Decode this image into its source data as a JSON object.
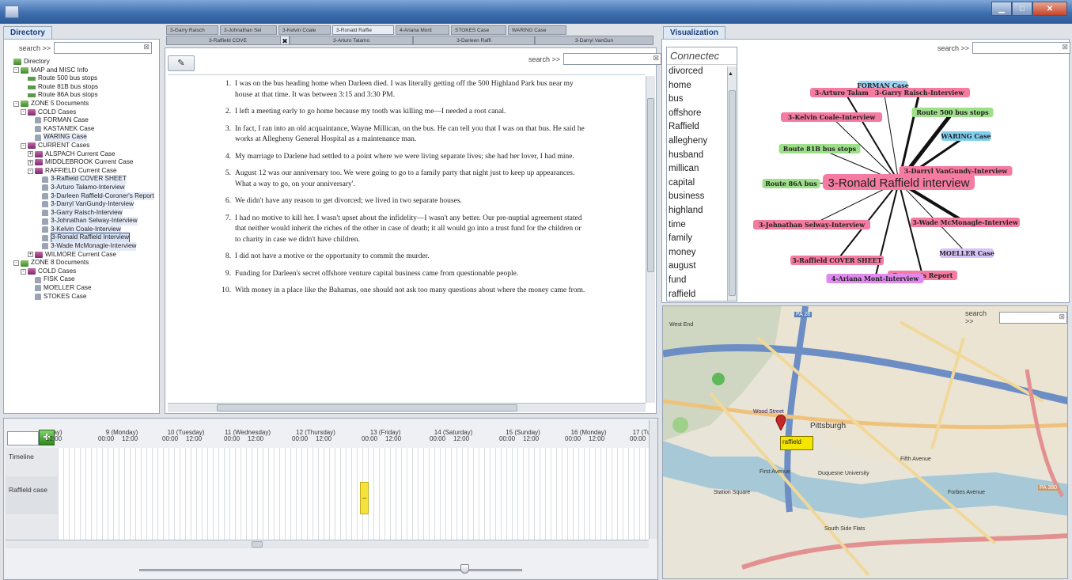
{
  "window": {
    "title": ""
  },
  "directory": {
    "tab": "Directory",
    "search_label": "search >>",
    "search_value": "",
    "tree": [
      {
        "label": "Directory",
        "level": 0,
        "icon": "folder-icon",
        "exp": ""
      },
      {
        "label": "MAP and MISC Info",
        "level": 1,
        "icon": "folder-icon",
        "exp": "-"
      },
      {
        "label": "Route 500 bus stops",
        "level": 2,
        "icon": "bus-icon",
        "exp": ""
      },
      {
        "label": "Route 81B bus stops",
        "level": 2,
        "icon": "bus-icon",
        "exp": ""
      },
      {
        "label": "Route 86A bus stops",
        "level": 2,
        "icon": "bus-icon",
        "exp": ""
      },
      {
        "label": "ZONE 5 Documents",
        "level": 1,
        "icon": "folder-icon",
        "exp": "-"
      },
      {
        "label": "COLD Cases",
        "level": 2,
        "icon": "case-icon",
        "exp": "-"
      },
      {
        "label": "FORMAN Case",
        "level": 3,
        "icon": "person-icon",
        "exp": ""
      },
      {
        "label": "KASTANEK Case",
        "level": 3,
        "icon": "person-icon",
        "exp": ""
      },
      {
        "label": "WARING Case",
        "level": 3,
        "icon": "person-icon",
        "exp": "",
        "hl": true
      },
      {
        "label": "CURRENT Cases",
        "level": 2,
        "icon": "case-icon",
        "exp": "-"
      },
      {
        "label": "ALSPACH Current Case",
        "level": 3,
        "icon": "case-icon",
        "exp": "+"
      },
      {
        "label": "MIDDLEBROOK Current Case",
        "level": 3,
        "icon": "case-icon",
        "exp": "+"
      },
      {
        "label": "RAFFIELD Current Case",
        "level": 3,
        "icon": "case-icon",
        "exp": "-"
      },
      {
        "label": "3-Raffield COVER SHEET",
        "level": 4,
        "icon": "person-icon",
        "exp": "",
        "hl": true
      },
      {
        "label": "3-Arturo Talamo-Interview",
        "level": 4,
        "icon": "person-icon",
        "exp": "",
        "hl": true
      },
      {
        "label": "3-Darleen Raffield-Coroner's Report",
        "level": 4,
        "icon": "person-icon",
        "exp": "",
        "hl": true
      },
      {
        "label": "3-Darryl VanGundy-Interview",
        "level": 4,
        "icon": "person-icon",
        "exp": "",
        "hl": true
      },
      {
        "label": "3-Garry Raisch-Interview",
        "level": 4,
        "icon": "person-icon",
        "exp": "",
        "hl": true
      },
      {
        "label": "3-Johnathan Selway-Interview",
        "level": 4,
        "icon": "person-icon",
        "exp": "",
        "hl": true
      },
      {
        "label": "3-Kelvin Coale-Interview",
        "level": 4,
        "icon": "person-icon",
        "exp": "",
        "hl": true
      },
      {
        "label": "3-Ronald Raffield Interview",
        "level": 4,
        "icon": "person-icon",
        "exp": "",
        "sel": true
      },
      {
        "label": "3-Wade McMonagle-Interview",
        "level": 4,
        "icon": "person-icon",
        "exp": "",
        "hl": true
      },
      {
        "label": "WILMORE Current Case",
        "level": 3,
        "icon": "case-icon",
        "exp": "+"
      },
      {
        "label": "ZONE 8 Documents",
        "level": 1,
        "icon": "folder-icon",
        "exp": "-"
      },
      {
        "label": "COLD Cases",
        "level": 2,
        "icon": "case-icon",
        "exp": "-"
      },
      {
        "label": "FISK Case",
        "level": 3,
        "icon": "person-icon",
        "exp": ""
      },
      {
        "label": "MOELLER Case",
        "level": 3,
        "icon": "person-icon",
        "exp": ""
      },
      {
        "label": "STOKES Case",
        "level": 3,
        "icon": "person-icon",
        "exp": ""
      }
    ]
  },
  "doc_tabs": {
    "row1": [
      "3-Garry Raisch",
      "3-Johnathan Sel",
      "3-Kelvin Coale",
      "3-Ronald Raffie",
      "4-Ariana Mont",
      "STOKES Case",
      "WARING Case"
    ],
    "row2": [
      "3-Raffield COVE",
      "3-Arturo Talamo",
      "3-Darleen Raffi",
      "3-Darryl VanGun"
    ],
    "close_glyph": "✖"
  },
  "document": {
    "search_label": "search >>",
    "items": [
      {
        "n": "1.",
        "text": "I was on the bus heading home when Darleen died.  I was literally getting off the 500 Highland Park bus near my house at that time.  It was between 3:15 and 3:30 PM."
      },
      {
        "n": "2.",
        "text": "I left a meeting early to go home because my tooth was killing me—I needed a root canal."
      },
      {
        "n": "3.",
        "text": "In fact, I ran into an old acquaintance, Wayne Millican, on the bus.  He can tell you that I was on that bus.  He said he works at Allegheny General Hospital as a maintenance man."
      },
      {
        "n": "4.",
        "text": "My marriage to Darlene had settled to a point where we were living separate lives; she had her lover, I had mine."
      },
      {
        "n": "5.",
        "text": "August 12 was our anniversary too.  We were going to go to a family party that night just to keep up appearances.  What a way to go, on your anniversary'."
      },
      {
        "n": "6.",
        "text": "We didn't have any reason to get divorced; we lived in two separate houses."
      },
      {
        "n": "7.",
        "text": "I had no motive to kill her. I wasn't upset about the infidelity—I wasn't any better. Our pre-nuptial agreement stated that neither would inherit the riches of the other in case of death; it all would go into a trust fund for the children or to charity in case we didn't have children."
      },
      {
        "n": "8.",
        "text": "I did not have a motive or the opportunity to commit the murder."
      },
      {
        "n": "9.",
        "text": "Funding for Darleen's secret offshore venture capital business came from questionable people."
      },
      {
        "n": "10.",
        "text": "With money in a place like the Bahamas, one should not ask too many questions about where the money came from."
      }
    ]
  },
  "timeline": {
    "days": [
      {
        "top": "ay)",
        "times": [
          "12:00"
        ]
      },
      {
        "top": "9 (Monday)",
        "times": [
          "00:00",
          "12:00"
        ]
      },
      {
        "top": "10 (Tuesday)",
        "times": [
          "00:00",
          "12:00"
        ]
      },
      {
        "top": "11 (Wednesday)",
        "times": [
          "00:00",
          "12:00"
        ]
      },
      {
        "top": "12 (Thursday)",
        "times": [
          "00:00",
          "12:00"
        ]
      },
      {
        "top": "13 (Friday)",
        "times": [
          "00:00",
          "12:00"
        ]
      },
      {
        "top": "14 (Saturday)",
        "times": [
          "00:00",
          "12:00"
        ]
      },
      {
        "top": "15 (Sunday)",
        "times": [
          "00:00",
          "12:00"
        ]
      },
      {
        "top": "16 (Monday)",
        "times": [
          "00:00",
          "12:00"
        ]
      },
      {
        "top": "17 (Tu",
        "times": [
          "00:00"
        ]
      }
    ],
    "rows": [
      "Timeline",
      "Raffield case"
    ],
    "add_glyph": "+",
    "event_glyph": "–"
  },
  "visualization": {
    "tab": "Visualization",
    "search_label": "search >>",
    "connected_header": "Connectec",
    "words": [
      "divorced",
      "home",
      "bus",
      "offshore",
      "Raffield",
      "allegheny",
      "husband",
      "millican",
      "capital",
      "business",
      "highland",
      "time",
      "family",
      "money",
      "august",
      "fund",
      "raffield"
    ],
    "center": "3-Ronald Raffield interview",
    "nodes": [
      {
        "label": "FORMAN Case",
        "color": "#9fd4f5"
      },
      {
        "label": "3-Arturo Talamo-",
        "color": "#f57ba0"
      },
      {
        "label": "3-Garry Raisch-Interview",
        "color": "#f57ba0"
      },
      {
        "label": "3-Kelvin Coale-Interview",
        "color": "#f57ba0"
      },
      {
        "label": "Route 500 bus stops",
        "color": "#9ee08a"
      },
      {
        "label": "WARING Case",
        "color": "#7fd0f0"
      },
      {
        "label": "Route 81B bus stops",
        "color": "#9ee08a"
      },
      {
        "label": "3-Darryl VanGundy-Interview",
        "color": "#f57ba0"
      },
      {
        "label": "Route 86A bus",
        "color": "#9ee08a"
      },
      {
        "label": "3-Johnathan Selway-Interview",
        "color": "#f57ba0"
      },
      {
        "label": "3-Wade McMonagle-Interview",
        "color": "#f57ba0"
      },
      {
        "label": "MOELLER Case",
        "color": "#d6c2f5"
      },
      {
        "label": "3-Raffield COVER SHEET",
        "color": "#f57ba0"
      },
      {
        "label": "Coroner's Report",
        "color": "#f57ba0"
      },
      {
        "label": "4-Ariana Mont-Interview",
        "color": "#e08af0"
      }
    ]
  },
  "map": {
    "search_label": "search >>",
    "marker_label": "raffield",
    "labels": [
      "West End",
      "Pittsburgh",
      "Wood Street",
      "First Avenue",
      "Duquesne University",
      "Station Square",
      "South Side Flats",
      "PA 28",
      "PA 380",
      "Fifth Avenue",
      "Forbes Avenue"
    ]
  },
  "colors": {
    "accent": "#2c5a98",
    "selected_tab": "#e8edf5",
    "event_yellow": "#f5e33c",
    "marker_red": "#c62828"
  }
}
